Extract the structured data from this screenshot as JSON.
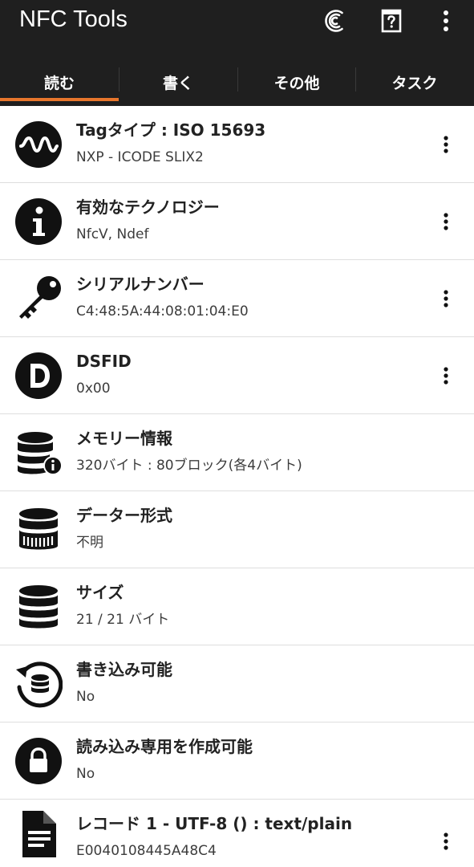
{
  "app": {
    "title": "NFC Tools"
  },
  "toolbar": {
    "icons": [
      "nfc-scan-icon",
      "help-icon",
      "more-vert-icon"
    ]
  },
  "tabs": [
    {
      "label": "読む",
      "selected": true
    },
    {
      "label": "書く",
      "selected": false
    },
    {
      "label": "その他",
      "selected": false
    },
    {
      "label": "タスク",
      "selected": false
    }
  ],
  "colors": {
    "appbar_bg": "#1f1f1f",
    "tab_indicator": "#e8762c",
    "icon": "#111111"
  },
  "rows": [
    {
      "title": "Tagタイプ : ISO 15693",
      "subtitle": "NXP - ICODE SLIX2",
      "icon": "waveform-icon",
      "has_menu": true
    },
    {
      "title": "有効なテクノロジー",
      "subtitle": "NfcV, Ndef",
      "icon": "info-icon",
      "has_menu": true
    },
    {
      "title": "シリアルナンバー",
      "subtitle": "C4:48:5A:44:08:01:04:E0",
      "icon": "key-icon",
      "has_menu": true
    },
    {
      "title": "DSFID",
      "subtitle": "0x00",
      "icon": "letter-d-icon",
      "has_menu": true
    },
    {
      "title": "メモリー情報",
      "subtitle": "320バイト : 80ブロック(各4バイト)",
      "icon": "database-info-icon",
      "has_menu": false
    },
    {
      "title": "データー形式",
      "subtitle": "不明",
      "icon": "database-format-icon",
      "has_menu": false
    },
    {
      "title": "サイズ",
      "subtitle": "21 / 21 バイト",
      "icon": "database-icon",
      "has_menu": false
    },
    {
      "title": "書き込み可能",
      "subtitle": "No",
      "icon": "database-refresh-icon",
      "has_menu": false
    },
    {
      "title": "読み込み専用を作成可能",
      "subtitle": "No",
      "icon": "lock-icon",
      "has_menu": false
    },
    {
      "title": "レコード 1 - UTF-8 () : text/plain",
      "subtitle": "E0040108445A48C4",
      "icon": "document-icon",
      "has_menu": true
    }
  ]
}
